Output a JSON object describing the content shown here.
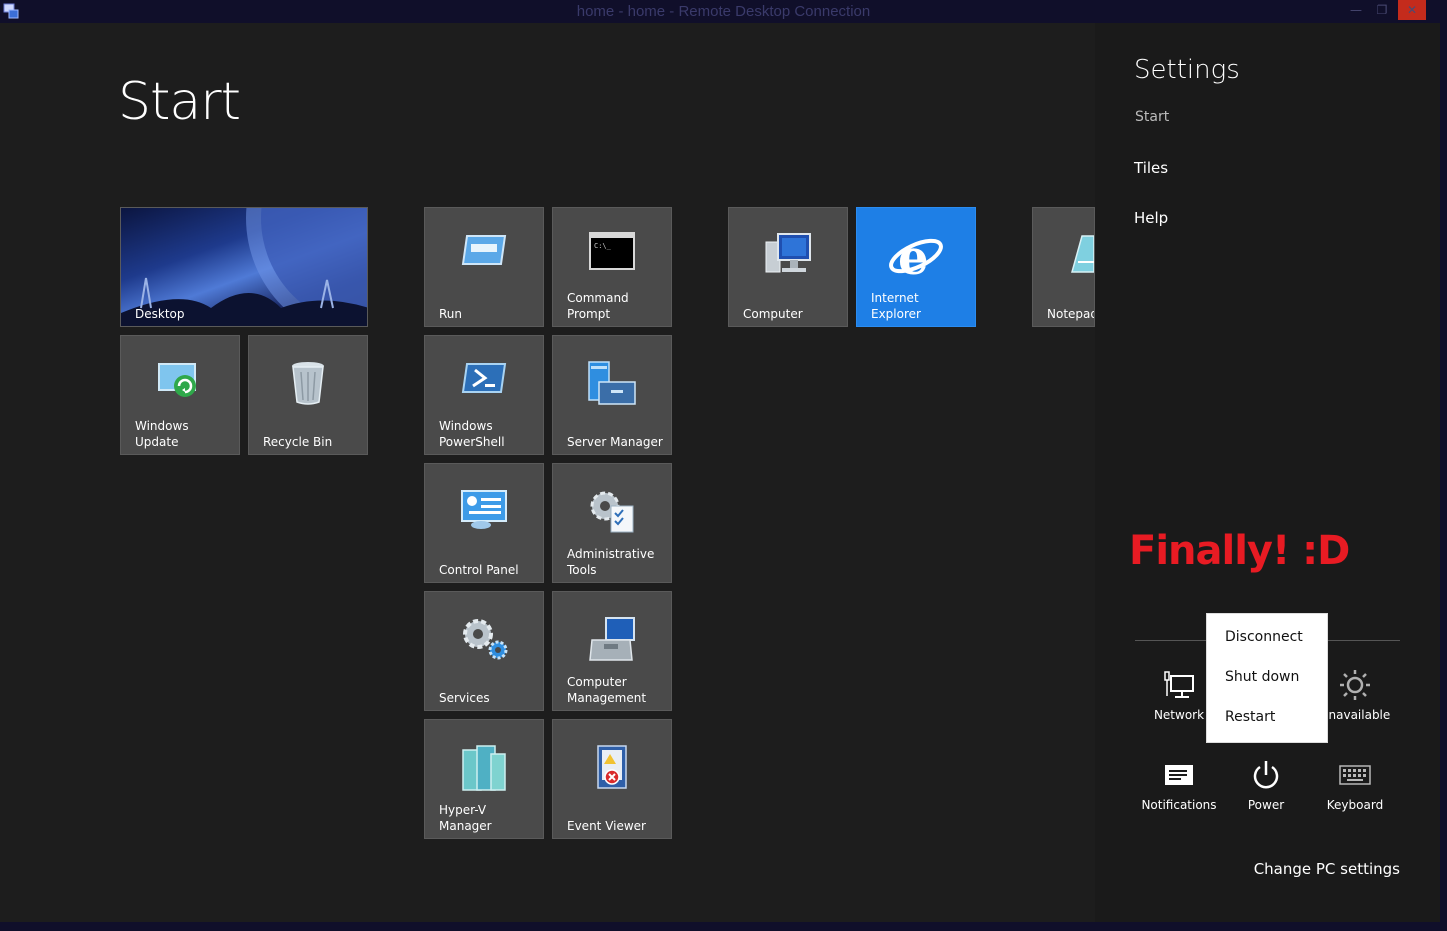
{
  "window": {
    "title": "home - home - Remote Desktop Connection",
    "minimize_glyph": "—",
    "restore_glyph": "❐",
    "close_glyph": "✕"
  },
  "start": {
    "title": "Start",
    "tiles": {
      "desktop": "Desktop",
      "windows_update": "Windows Update",
      "recycle_bin": "Recycle Bin",
      "run": "Run",
      "command_prompt": "Command\nPrompt",
      "windows_powershell": "Windows\nPowerShell",
      "server_manager": "Server Manager",
      "control_panel": "Control Panel",
      "administrative_tools": "Administrative\nTools",
      "services": "Services",
      "computer_management": "Computer\nManagement",
      "hyperv_manager": "Hyper-V\nManager",
      "event_viewer": "Event Viewer",
      "computer": "Computer",
      "internet_explorer": "Internet Explorer",
      "notepad": "Notepad"
    }
  },
  "settings": {
    "title": "Settings",
    "subtitle": "Start",
    "items": [
      "Tiles",
      "Help"
    ],
    "annotation": "Finally! :D",
    "quick": {
      "network": "Network",
      "unavailable": "Unavailable",
      "notifications": "Notifications",
      "power": "Power",
      "keyboard": "Keyboard"
    },
    "change_pc_settings": "Change PC settings"
  },
  "power_menu": {
    "items": [
      "Disconnect",
      "Shut down",
      "Restart"
    ]
  },
  "colors": {
    "annotation": "#e81b23",
    "ie_tile": "#1e7fe6",
    "close_button": "#c42b1c"
  }
}
